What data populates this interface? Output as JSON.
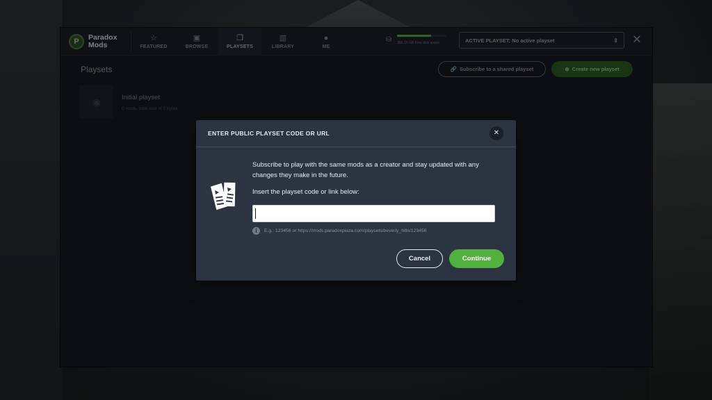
{
  "app": {
    "logo_line1": "Paradox",
    "logo_line2": "Mods",
    "logo_icon": "paradox-mods-logo"
  },
  "nav": [
    {
      "label": "FEATURED",
      "icon": "star-icon",
      "glyph": "☆",
      "active": false
    },
    {
      "label": "BROWSE",
      "icon": "browse-icon",
      "glyph": "▣",
      "active": false
    },
    {
      "label": "PLAYSETS",
      "icon": "playsets-icon",
      "glyph": "❒",
      "active": true
    },
    {
      "label": "LIBRARY",
      "icon": "library-icon",
      "glyph": "▥",
      "active": false
    },
    {
      "label": "ME",
      "icon": "user-icon",
      "glyph": "●",
      "active": false
    }
  ],
  "disk": {
    "text": "386.16 GB Free disk space",
    "used_fraction": 0.7
  },
  "active_playset": {
    "label": "ACTIVE PLAYSET: No active playset"
  },
  "playsets_page": {
    "title": "Playsets",
    "subscribe_button": "Subscribe to a shared playset",
    "create_button": "Create new playset",
    "playset": {
      "name": "Initial playset",
      "meta": "0 mods, total size of 0 bytes"
    }
  },
  "modal": {
    "title": "ENTER PUBLIC PLAYSET CODE OR URL",
    "description": "Subscribe to play with the same mods as a creator and stay updated with any changes they make in the future.",
    "input_label": "Insert the playset code or link below:",
    "input_value": "",
    "hint": "E.g.: 123456 or https://mods.paradoxplaza.com/playsets/beverly_hills/123456",
    "cancel_label": "Cancel",
    "continue_label": "Continue"
  },
  "colors": {
    "accent_green": "#50b13c",
    "modal_bg": "#2c3442"
  }
}
